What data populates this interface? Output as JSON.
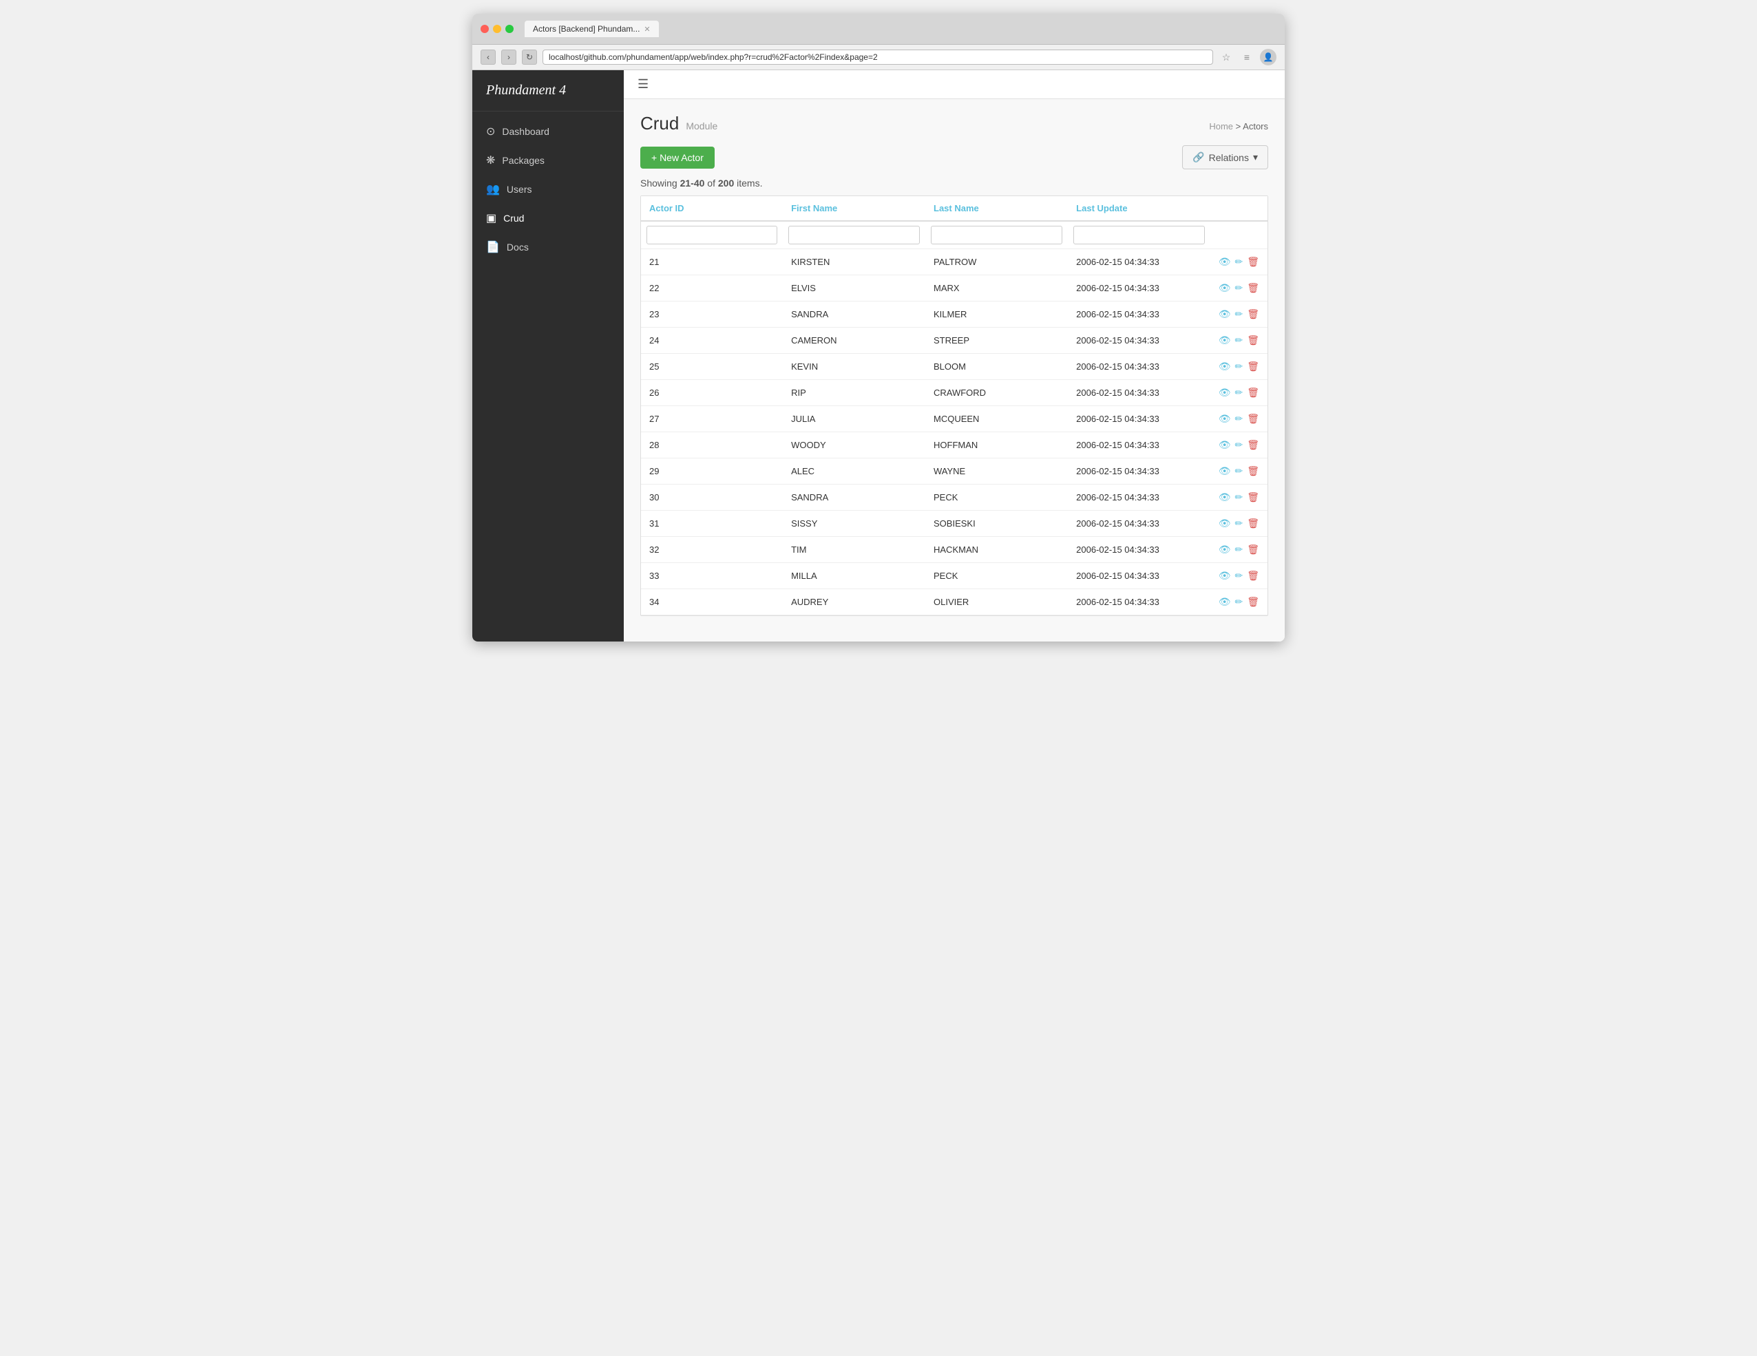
{
  "browser": {
    "tab_title": "Actors [Backend] Phundam...",
    "url": "localhost/github.com/phundament/app/web/index.php?r=crud%2Factor%2Findex&page=2"
  },
  "sidebar": {
    "brand": "Phundament 4",
    "items": [
      {
        "id": "dashboard",
        "label": "Dashboard",
        "icon": "⊙"
      },
      {
        "id": "packages",
        "label": "Packages",
        "icon": "❋"
      },
      {
        "id": "users",
        "label": "Users",
        "icon": "👥"
      },
      {
        "id": "crud",
        "label": "Crud",
        "icon": "▣"
      },
      {
        "id": "docs",
        "label": "Docs",
        "icon": "📄"
      }
    ]
  },
  "topbar": {
    "hamburger": "☰"
  },
  "page": {
    "title": "Crud",
    "subtitle": "Module",
    "breadcrumb_home": "Home",
    "breadcrumb_separator": ">",
    "breadcrumb_current": "Actors"
  },
  "toolbar": {
    "new_button": "+ New Actor",
    "relations_button": "Relations",
    "relations_icon": "🔗",
    "dropdown_arrow": "▾"
  },
  "table": {
    "showing_prefix": "Showing ",
    "showing_range": "21-40",
    "showing_middle": " of ",
    "showing_total": "200",
    "showing_suffix": " items.",
    "columns": [
      {
        "id": "actor_id",
        "label": "Actor ID"
      },
      {
        "id": "first_name",
        "label": "First Name"
      },
      {
        "id": "last_name",
        "label": "Last Name"
      },
      {
        "id": "last_update",
        "label": "Last Update"
      },
      {
        "id": "actions",
        "label": ""
      }
    ],
    "rows": [
      {
        "id": "21",
        "first_name": "KIRSTEN",
        "last_name": "PALTROW",
        "last_update": "2006-02-15 04:34:33"
      },
      {
        "id": "22",
        "first_name": "ELVIS",
        "last_name": "MARX",
        "last_update": "2006-02-15 04:34:33"
      },
      {
        "id": "23",
        "first_name": "SANDRA",
        "last_name": "KILMER",
        "last_update": "2006-02-15 04:34:33"
      },
      {
        "id": "24",
        "first_name": "CAMERON",
        "last_name": "STREEP",
        "last_update": "2006-02-15 04:34:33"
      },
      {
        "id": "25",
        "first_name": "KEVIN",
        "last_name": "BLOOM",
        "last_update": "2006-02-15 04:34:33"
      },
      {
        "id": "26",
        "first_name": "RIP",
        "last_name": "CRAWFORD",
        "last_update": "2006-02-15 04:34:33"
      },
      {
        "id": "27",
        "first_name": "JULIA",
        "last_name": "MCQUEEN",
        "last_update": "2006-02-15 04:34:33"
      },
      {
        "id": "28",
        "first_name": "WOODY",
        "last_name": "HOFFMAN",
        "last_update": "2006-02-15 04:34:33"
      },
      {
        "id": "29",
        "first_name": "ALEC",
        "last_name": "WAYNE",
        "last_update": "2006-02-15 04:34:33"
      },
      {
        "id": "30",
        "first_name": "SANDRA",
        "last_name": "PECK",
        "last_update": "2006-02-15 04:34:33"
      },
      {
        "id": "31",
        "first_name": "SISSY",
        "last_name": "SOBIESKI",
        "last_update": "2006-02-15 04:34:33"
      },
      {
        "id": "32",
        "first_name": "TIM",
        "last_name": "HACKMAN",
        "last_update": "2006-02-15 04:34:33"
      },
      {
        "id": "33",
        "first_name": "MILLA",
        "last_name": "PECK",
        "last_update": "2006-02-15 04:34:33"
      },
      {
        "id": "34",
        "first_name": "AUDREY",
        "last_name": "OLIVIER",
        "last_update": "2006-02-15 04:34:33"
      }
    ]
  }
}
